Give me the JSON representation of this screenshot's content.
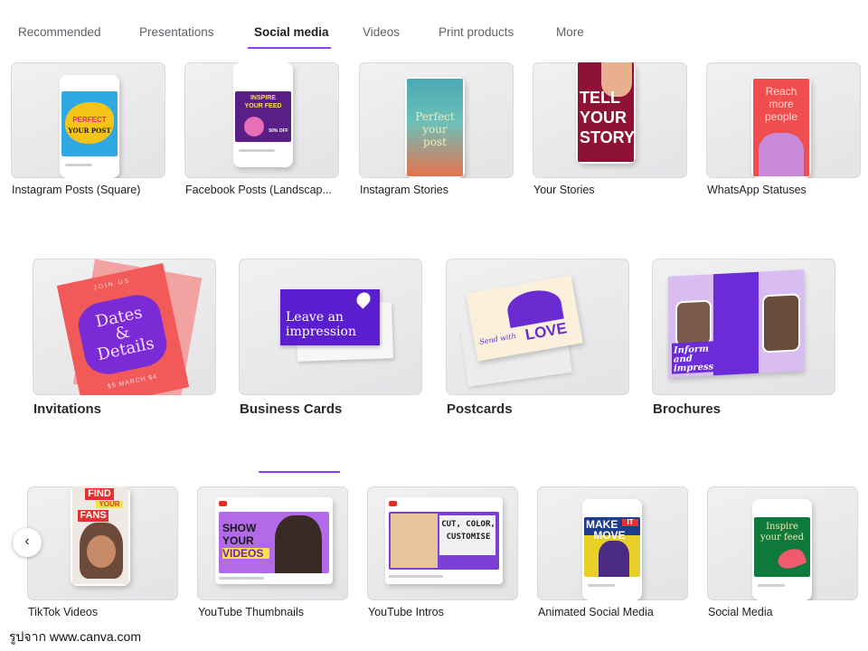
{
  "tabs": [
    {
      "label": "Recommended"
    },
    {
      "label": "Presentations"
    },
    {
      "label": "Social media"
    },
    {
      "label": "Videos"
    },
    {
      "label": "Print products"
    },
    {
      "label": "More"
    }
  ],
  "active_tab": "Social media",
  "row1": [
    {
      "label": "Instagram Posts (Square)",
      "art": [
        "PERFECT",
        "YOUR POST"
      ]
    },
    {
      "label": "Facebook Posts (Landscap...",
      "art": [
        "INSPIRE",
        "YOUR FEED",
        "50% OFF"
      ]
    },
    {
      "label": "Instagram Stories",
      "art": [
        "Perfect",
        "your",
        "post"
      ]
    },
    {
      "label": "Your Stories",
      "art": [
        "TELL",
        "YOUR",
        "STORY"
      ]
    },
    {
      "label": "WhatsApp Statuses",
      "art": [
        "Reach",
        "more",
        "people"
      ]
    }
  ],
  "row2": [
    {
      "label": "Invitations",
      "art": [
        "JOIN US",
        "Dates",
        "&",
        "Details",
        "$5 MARCH $4"
      ]
    },
    {
      "label": "Business Cards",
      "art": [
        "Leave an",
        "impression"
      ]
    },
    {
      "label": "Postcards",
      "art": [
        "Send with",
        "LOVE"
      ]
    },
    {
      "label": "Brochures",
      "art": [
        "Inform",
        "and",
        "impress"
      ]
    }
  ],
  "row3": [
    {
      "label": "TikTok Videos",
      "art": [
        "FIND",
        "YOUR",
        "FANS"
      ]
    },
    {
      "label": "YouTube Thumbnails",
      "art": [
        "SHOW",
        "YOUR",
        "VIDEOS"
      ]
    },
    {
      "label": "YouTube Intros",
      "art": [
        "CUT, COLOR,",
        "CUSTOMISE"
      ]
    },
    {
      "label": "Animated Social Media",
      "art": [
        "MAKE",
        "IT",
        "MOVE"
      ]
    },
    {
      "label": "Social Media",
      "art": [
        "Inspire",
        "your feed"
      ]
    }
  ],
  "nav": {
    "prev_icon": "chevron-left-icon",
    "prev_glyph": "‹"
  },
  "credit": "รูปจาก www.canva.com",
  "colors": {
    "accent": "#8b3dff",
    "text": "#1f1f1f",
    "muted": "#5f6368"
  }
}
